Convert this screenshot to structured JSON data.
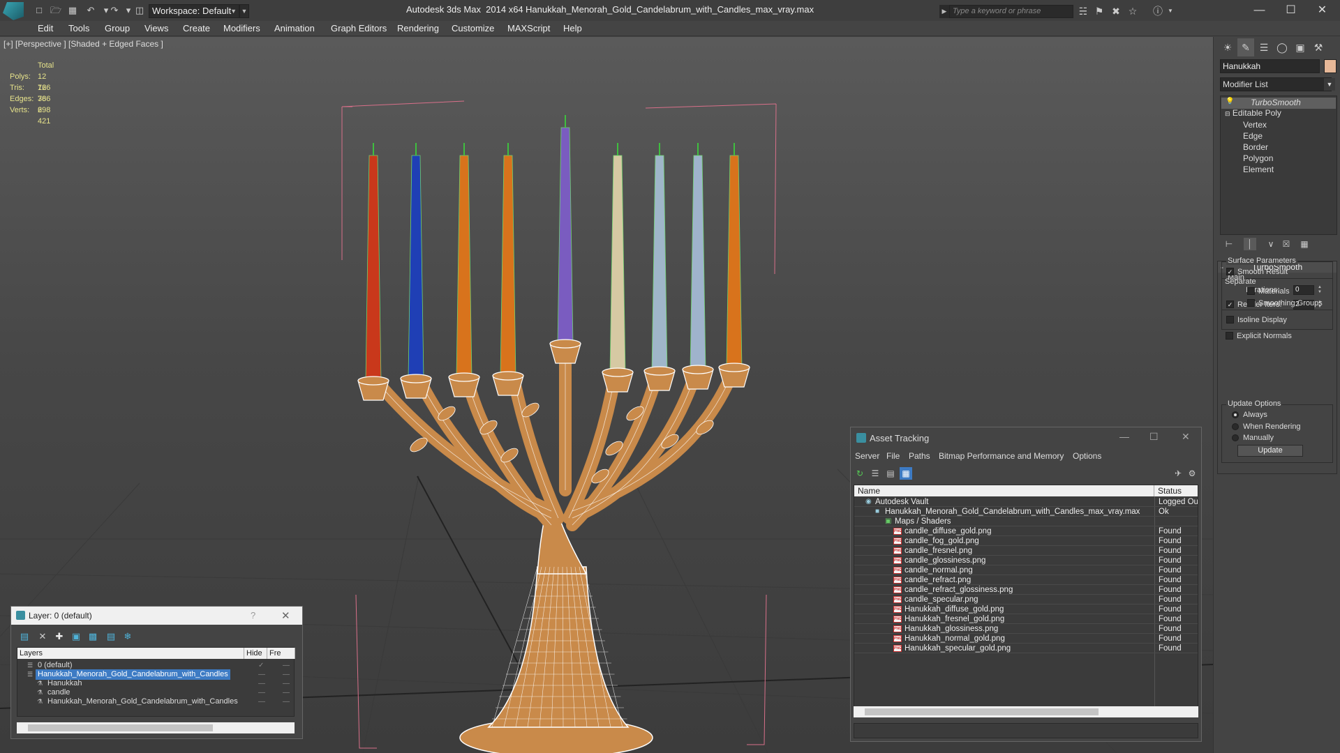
{
  "titlebar": {
    "workspace": "Workspace: Default",
    "app_title": "Autodesk 3ds Max  2014 x64",
    "doc_title": "Hanukkah_Menorah_Gold_Candelabrum_with_Candles_max_vray.max",
    "search_placeholder": "Type a keyword or phrase"
  },
  "menubar": [
    "Edit",
    "Tools",
    "Group",
    "Views",
    "Create",
    "Modifiers",
    "Animation",
    "Graph Editors",
    "Rendering",
    "Customize",
    "MAXScript",
    "Help"
  ],
  "viewport": {
    "label": "[+] [Perspective ] [Shaded + Edged Faces ]",
    "stats_header": "Total",
    "stats": [
      {
        "k": "Polys:",
        "v": "12 766"
      },
      {
        "k": "Tris:",
        "v": "12 766"
      },
      {
        "k": "Edges:",
        "v": "38 298"
      },
      {
        "k": "Verts:",
        "v": "6 421"
      }
    ],
    "candle_colors": [
      "#c9381b",
      "#1f3fb5",
      "#d8731c",
      "#d8731c",
      "#7a5cc0",
      "#d6c9a3",
      "#9fb6c9",
      "#9fb3cc",
      "#d8731c"
    ],
    "gold_color": "#c98a4a"
  },
  "command_panel": {
    "object_name": "Hanukkah",
    "object_color": "#e7b898",
    "modifier_list": "Modifier List",
    "stack": [
      {
        "label": "TurboSmooth",
        "italic": true,
        "selected": true
      },
      {
        "label": "Editable Poly"
      },
      {
        "label": "Vertex"
      },
      {
        "label": "Edge"
      },
      {
        "label": "Border"
      },
      {
        "label": "Polygon"
      },
      {
        "label": "Element"
      }
    ],
    "turbosmooth": {
      "title": "TurboSmooth",
      "main": "Main",
      "iterations_label": "Iterations:",
      "iterations": "0",
      "render_iters_label": "Render Iters:",
      "render_iters": "2",
      "isoline": "Isoline Display",
      "explicit_normals": "Explicit Normals",
      "surface_params": "Surface Parameters",
      "smooth_result": "Smooth Result",
      "separate": "Separate",
      "materials": "Materials",
      "smoothing_groups": "Smoothing Groups",
      "update_options": "Update Options",
      "always": "Always",
      "when_rendering": "When Rendering",
      "manually": "Manually",
      "update": "Update"
    }
  },
  "layer_dialog": {
    "title": "Layer: 0 (default)",
    "headers": {
      "layers": "Layers",
      "hide": "Hide",
      "freeze": "Fre"
    },
    "rows": [
      {
        "name": "0 (default)",
        "indent": 26,
        "selected": false
      },
      {
        "name": "Hanukkah_Menorah_Gold_Candelabrum_with_Candles",
        "indent": 26,
        "selected": true
      },
      {
        "name": "Hanukkah",
        "indent": 40,
        "selected": false
      },
      {
        "name": "candle",
        "indent": 40,
        "selected": false
      },
      {
        "name": "Hanukkah_Menorah_Gold_Candelabrum_with_Candles",
        "indent": 40,
        "selected": false
      }
    ]
  },
  "asset_tracking": {
    "title": "Asset Tracking",
    "menu": [
      "Server",
      "File",
      "Paths",
      "Bitmap Performance and Memory",
      "Options"
    ],
    "headers": {
      "name": "Name",
      "status": "Status"
    },
    "rows": [
      {
        "name": "Autodesk Vault",
        "status": "Logged Ou",
        "indent": 30,
        "kind": "vault"
      },
      {
        "name": "Hanukkah_Menorah_Gold_Candelabrum_with_Candles_max_vray.max",
        "status": "Ok",
        "indent": 44,
        "kind": "max"
      },
      {
        "name": "Maps / Shaders",
        "status": "",
        "indent": 58,
        "kind": "folder"
      },
      {
        "name": "candle_diffuse_gold.png",
        "status": "Found",
        "indent": 72,
        "kind": "png"
      },
      {
        "name": "candle_fog_gold.png",
        "status": "Found",
        "indent": 72,
        "kind": "png"
      },
      {
        "name": "candle_fresnel.png",
        "status": "Found",
        "indent": 72,
        "kind": "png"
      },
      {
        "name": "candle_glossiness.png",
        "status": "Found",
        "indent": 72,
        "kind": "png"
      },
      {
        "name": "candle_normal.png",
        "status": "Found",
        "indent": 72,
        "kind": "png"
      },
      {
        "name": "candle_refract.png",
        "status": "Found",
        "indent": 72,
        "kind": "png"
      },
      {
        "name": "candle_refract_glossiness.png",
        "status": "Found",
        "indent": 72,
        "kind": "png"
      },
      {
        "name": "candle_specular.png",
        "status": "Found",
        "indent": 72,
        "kind": "png"
      },
      {
        "name": "Hanukkah_diffuse_gold.png",
        "status": "Found",
        "indent": 72,
        "kind": "png"
      },
      {
        "name": "Hanukkah_fresnel_gold.png",
        "status": "Found",
        "indent": 72,
        "kind": "png"
      },
      {
        "name": "Hanukkah_glossiness.png",
        "status": "Found",
        "indent": 72,
        "kind": "png"
      },
      {
        "name": "Hanukkah_normal_gold.png",
        "status": "Found",
        "indent": 72,
        "kind": "png"
      },
      {
        "name": "Hanukkah_specular_gold.png",
        "status": "Found",
        "indent": 72,
        "kind": "png"
      }
    ]
  }
}
